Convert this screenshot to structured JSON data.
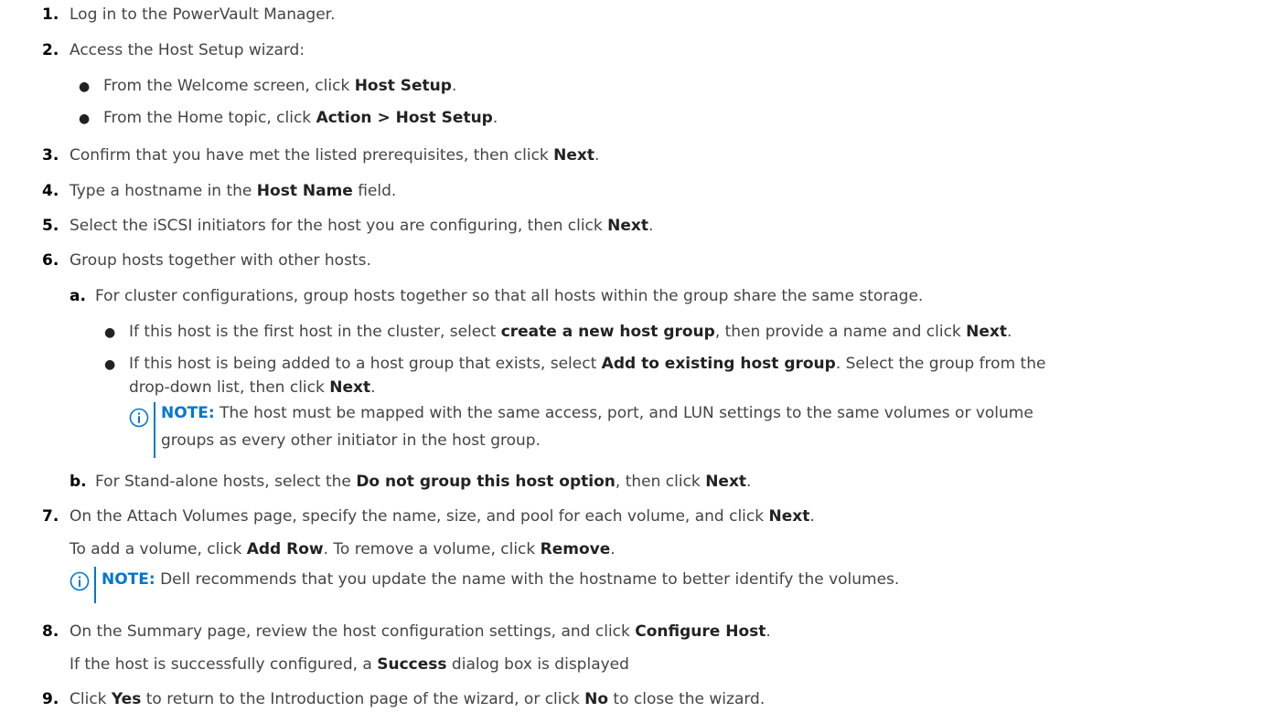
{
  "colors": {
    "text": "#444444",
    "bold_text": "#222222",
    "note_accent": "#0076ce",
    "step_number": "#000000"
  },
  "steps": [
    {
      "num": "1.",
      "parts": [
        {
          "t": "Log in to the PowerVault Manager."
        }
      ]
    },
    {
      "num": "2.",
      "parts": [
        {
          "t": "Access the Host Setup wizard:"
        }
      ]
    },
    {
      "num": "3.",
      "parts": [
        {
          "t": "Confirm that you have met the listed prerequisites, then click "
        },
        {
          "t": "Next",
          "b": true
        },
        {
          "t": "."
        }
      ]
    },
    {
      "num": "4.",
      "parts": [
        {
          "t": "Type a hostname in the "
        },
        {
          "t": "Host Name",
          "b": true
        },
        {
          "t": " field."
        }
      ]
    },
    {
      "num": "5.",
      "parts": [
        {
          "t": "Select the iSCSI initiators for the host you are configuring, then click "
        },
        {
          "t": "Next",
          "b": true
        },
        {
          "t": "."
        }
      ]
    },
    {
      "num": "6.",
      "parts": [
        {
          "t": "Group hosts together with other hosts."
        }
      ]
    },
    {
      "num": "7.",
      "parts": [
        {
          "t": "On the Attach Volumes page, specify the name, size, and pool for each volume, and click "
        },
        {
          "t": "Next",
          "b": true
        },
        {
          "t": "."
        }
      ]
    },
    {
      "num": "8.",
      "parts": [
        {
          "t": "On the Summary page, review the host configuration settings, and click "
        },
        {
          "t": "Configure Host",
          "b": true
        },
        {
          "t": "."
        }
      ]
    },
    {
      "num": "9.",
      "parts": [
        {
          "t": "Click "
        },
        {
          "t": "Yes",
          "b": true
        },
        {
          "t": " to return to the Introduction page of the wizard, or click "
        },
        {
          "t": "No",
          "b": true
        },
        {
          "t": " to close the wizard."
        }
      ]
    }
  ],
  "step2_bullets": [
    {
      "parts": [
        {
          "t": "From the Welcome screen, click "
        },
        {
          "t": "Host Setup",
          "b": true
        },
        {
          "t": "."
        }
      ]
    },
    {
      "parts": [
        {
          "t": "From the Home topic, click "
        },
        {
          "t": "Action > Host Setup",
          "b": true
        },
        {
          "t": "."
        }
      ]
    }
  ],
  "step6_sub": [
    {
      "letter": "a.",
      "parts": [
        {
          "t": "For cluster configurations, group hosts together so that all hosts within the group share the same storage."
        }
      ]
    },
    {
      "letter": "b.",
      "parts": [
        {
          "t": "For Stand-alone hosts, select the "
        },
        {
          "t": "Do not group this host option",
          "b": true
        },
        {
          "t": ", then click "
        },
        {
          "t": "Next",
          "b": true
        },
        {
          "t": "."
        }
      ]
    }
  ],
  "step6a_bullets": [
    {
      "parts": [
        {
          "t": "If this host is the first host in the cluster, select "
        },
        {
          "t": "create a new host group",
          "b": true
        },
        {
          "t": ", then provide a name and click "
        },
        {
          "t": "Next",
          "b": true
        },
        {
          "t": "."
        }
      ]
    },
    {
      "parts": [
        {
          "t": "If this host is being added to a host group that exists, select "
        },
        {
          "t": "Add to existing host group",
          "b": true
        },
        {
          "t": ". Select the group from the"
        }
      ]
    },
    {
      "parts": [
        {
          "t": "drop-down list, then click "
        },
        {
          "t": "Next",
          "b": true
        },
        {
          "t": "."
        }
      ]
    }
  ],
  "note1": {
    "label": "NOTE:",
    "line1": " The host must be mapped with the same access, port, and LUN settings to the same volumes or volume",
    "line2": "groups as every other initiator in the host group."
  },
  "step7_extra": [
    {
      "parts": [
        {
          "t": "To add a volume, click "
        },
        {
          "t": "Add Row",
          "b": true
        },
        {
          "t": ". To remove a volume, click "
        },
        {
          "t": "Remove",
          "b": true
        },
        {
          "t": "."
        }
      ]
    }
  ],
  "note2": {
    "label": "NOTE:",
    "line1": " Dell recommends that you update the name with the hostname to better identify the volumes."
  },
  "step8_extra": [
    {
      "parts": [
        {
          "t": "If the host is successfully configured, a "
        },
        {
          "t": "Success",
          "b": true
        },
        {
          "t": " dialog box is displayed"
        }
      ]
    }
  ],
  "icons": {
    "note_icon": "info-icon"
  }
}
